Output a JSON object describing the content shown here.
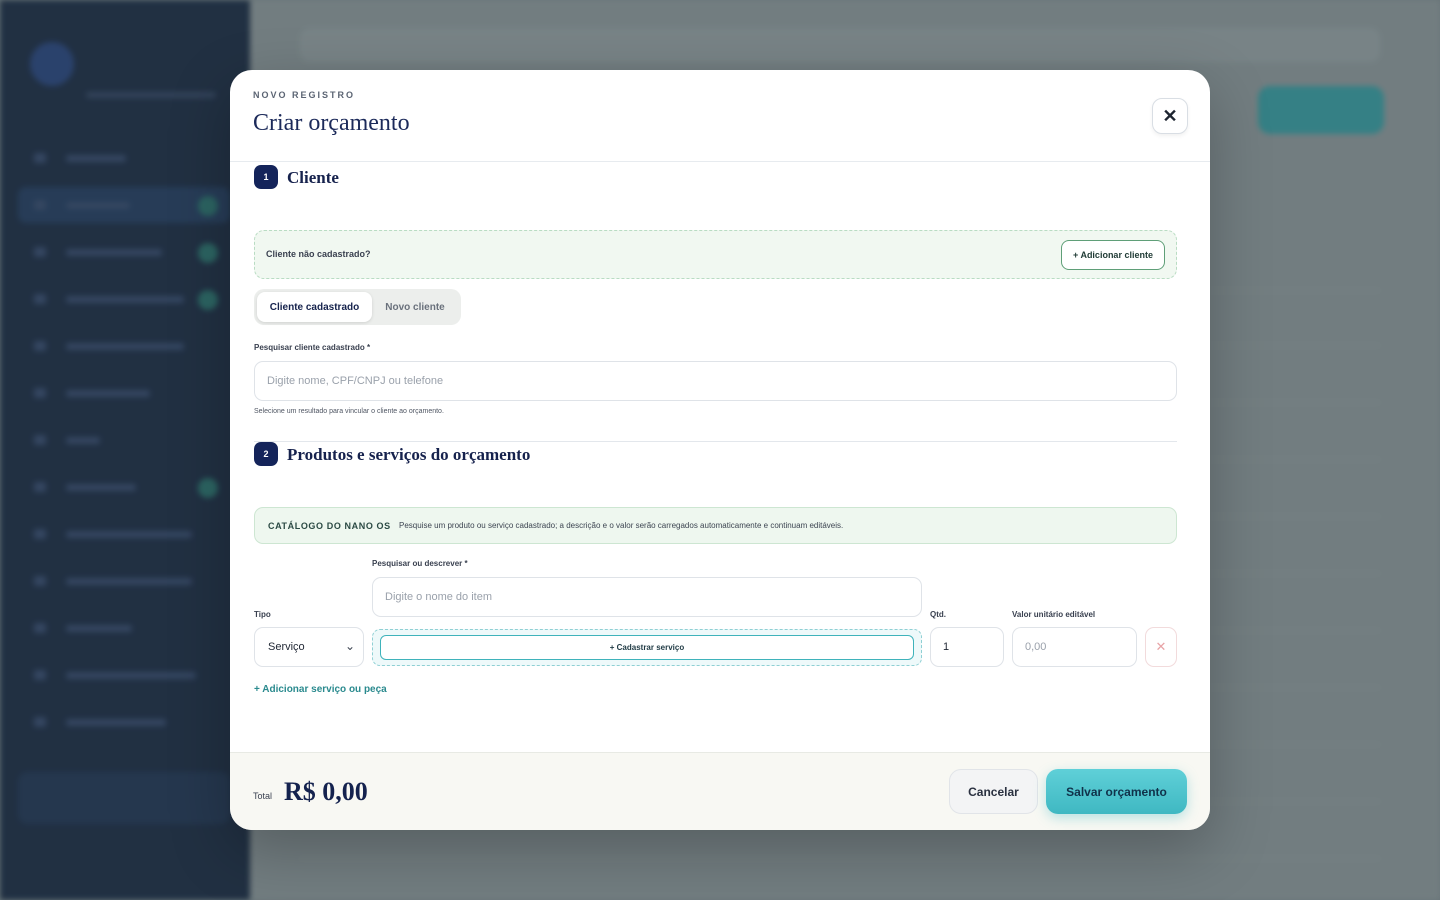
{
  "modal": {
    "eyebrow": "NOVO REGISTRO",
    "title": "Criar orçamento",
    "close_label": "✕"
  },
  "section1": {
    "number": "1",
    "title": "Cliente",
    "notice_text": "Cliente não cadastrado?",
    "add_client_label": "+ Adicionar cliente",
    "tabs": [
      {
        "label": "Cliente cadastrado",
        "active": true
      },
      {
        "label": "Novo cliente",
        "active": false
      }
    ],
    "search_label": "Pesquisar cliente cadastrado *",
    "search_placeholder": "Digite nome, CPF/CNPJ ou telefone",
    "hint": "Selecione um resultado para vincular o cliente ao orçamento."
  },
  "section2": {
    "number": "2",
    "title": "Produtos e serviços do orçamento",
    "catalog_tag": "CATÁLOGO DO NANO OS",
    "catalog_text": "Pesquise um produto ou serviço cadastrado; a descrição e o valor serão carregados automaticamente e continuam editáveis.",
    "item_search_label": "Pesquisar ou descrever *",
    "item_search_placeholder": "Digite o nome do item",
    "type_label": "Tipo",
    "type_value": "Serviço",
    "register_service_label": "+ Cadastrar serviço",
    "qty_label": "Qtd.",
    "qty_value": "1",
    "unit_value_label": "Valor unitário editável",
    "unit_value_placeholder": "0,00",
    "remove_label": "✕",
    "add_item_label": "+ Adicionar serviço ou peça"
  },
  "footer": {
    "total_label": "Total",
    "total_value": "R$ 0,00",
    "cancel_label": "Cancelar",
    "save_label": "Salvar orçamento"
  },
  "colors": {
    "primary_navy": "#14224e",
    "accent_teal": "#3fb8c2",
    "success_green": "#5f9f78"
  }
}
